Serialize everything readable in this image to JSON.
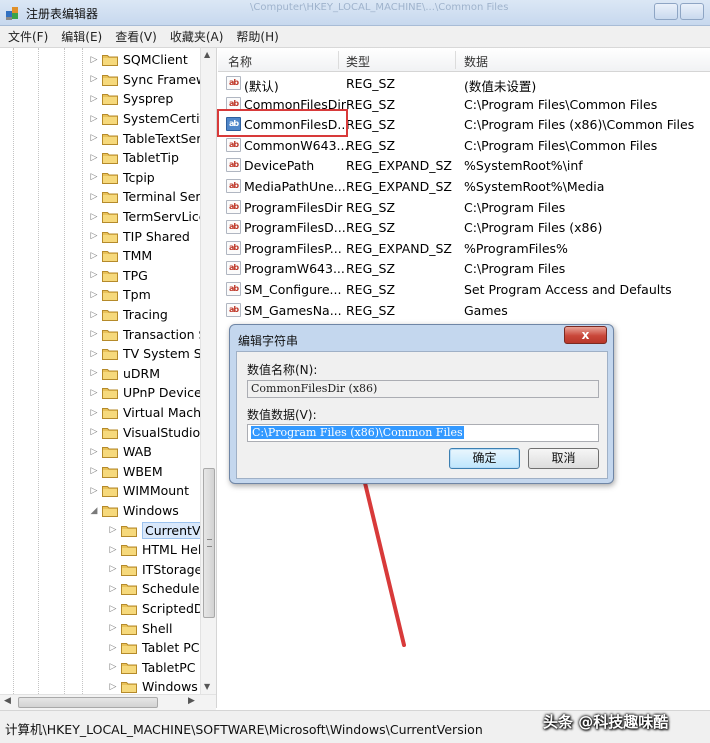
{
  "window": {
    "title": "注册表编辑器",
    "ghost_title": "\\Computer\\HKEY_LOCAL_MACHINE\\...\\Common Files"
  },
  "menu": [
    "文件(F)",
    "编辑(E)",
    "查看(V)",
    "收藏夹(A)",
    "帮助(H)"
  ],
  "tree": {
    "items": [
      {
        "label": "SQMClient",
        "level": 0
      },
      {
        "label": "Sync Framew",
        "level": 0
      },
      {
        "label": "Sysprep",
        "level": 0
      },
      {
        "label": "SystemCertifi",
        "level": 0
      },
      {
        "label": "TableTextSer",
        "level": 0
      },
      {
        "label": "TabletTip",
        "level": 0
      },
      {
        "label": "Tcpip",
        "level": 0
      },
      {
        "label": "Terminal Serv",
        "level": 0
      },
      {
        "label": "TermServLice",
        "level": 0
      },
      {
        "label": "TIP Shared",
        "level": 0
      },
      {
        "label": "TMM",
        "level": 0
      },
      {
        "label": "TPG",
        "level": 0
      },
      {
        "label": "Tpm",
        "level": 0
      },
      {
        "label": "Tracing",
        "level": 0
      },
      {
        "label": "Transaction S",
        "level": 0
      },
      {
        "label": "TV System Se",
        "level": 0
      },
      {
        "label": "uDRM",
        "level": 0
      },
      {
        "label": "UPnP Device",
        "level": 0
      },
      {
        "label": "Virtual Machi",
        "level": 0
      },
      {
        "label": "VisualStudio",
        "level": 0
      },
      {
        "label": "WAB",
        "level": 0
      },
      {
        "label": "WBEM",
        "level": 0
      },
      {
        "label": "WIMMount",
        "level": 0
      },
      {
        "label": "Windows",
        "level": 0,
        "expanded": true
      },
      {
        "label": "CurrentVe",
        "level": 1,
        "selected": true
      },
      {
        "label": "HTML Hel",
        "level": 1
      },
      {
        "label": "ITStorage",
        "level": 1
      },
      {
        "label": "Schedulec",
        "level": 1
      },
      {
        "label": "ScriptedD",
        "level": 1
      },
      {
        "label": "Shell",
        "level": 1
      },
      {
        "label": "Tablet PC",
        "level": 1
      },
      {
        "label": "TabletPC",
        "level": 1
      },
      {
        "label": "Windows",
        "level": 1
      }
    ]
  },
  "list": {
    "columns": [
      "名称",
      "类型",
      "数据"
    ],
    "rows": [
      {
        "name": "(默认)",
        "type": "REG_SZ",
        "data": "(数值未设置)"
      },
      {
        "name": "CommonFilesDir",
        "type": "REG_SZ",
        "data": "C:\\Program Files\\Common Files"
      },
      {
        "name": "CommonFilesD...",
        "type": "REG_SZ",
        "data": "C:\\Program Files (x86)\\Common Files",
        "highlight": true
      },
      {
        "name": "CommonW643...",
        "type": "REG_SZ",
        "data": "C:\\Program Files\\Common Files"
      },
      {
        "name": "DevicePath",
        "type": "REG_EXPAND_SZ",
        "data": "%SystemRoot%\\inf"
      },
      {
        "name": "MediaPathUne...",
        "type": "REG_EXPAND_SZ",
        "data": "%SystemRoot%\\Media"
      },
      {
        "name": "ProgramFilesDir",
        "type": "REG_SZ",
        "data": "C:\\Program Files"
      },
      {
        "name": "ProgramFilesD...",
        "type": "REG_SZ",
        "data": "C:\\Program Files (x86)"
      },
      {
        "name": "ProgramFilesP...",
        "type": "REG_EXPAND_SZ",
        "data": "%ProgramFiles%"
      },
      {
        "name": "ProgramW643...",
        "type": "REG_SZ",
        "data": "C:\\Program Files"
      },
      {
        "name": "SM_Configure...",
        "type": "REG_SZ",
        "data": "Set Program Access and Defaults"
      },
      {
        "name": "SM_GamesNa...",
        "type": "REG_SZ",
        "data": "Games"
      }
    ]
  },
  "dialog": {
    "title": "编辑字符串",
    "close_label": "x",
    "name_label": "数值名称(N):",
    "name_value": "CommonFilesDir (x86)",
    "data_label": "数值数据(V):",
    "data_value": "C:\\Program Files (x86)\\Common Files",
    "ok_label": "确定",
    "cancel_label": "取消"
  },
  "status": {
    "path": "计算机\\HKEY_LOCAL_MACHINE\\SOFTWARE\\Microsoft\\Windows\\CurrentVersion"
  },
  "watermark": "头条 @科技趣味酷",
  "colors": {
    "annotation_red": "#d83a3a",
    "selection_blue": "#3399ff",
    "dialog_frame": "#c4d7ee"
  }
}
